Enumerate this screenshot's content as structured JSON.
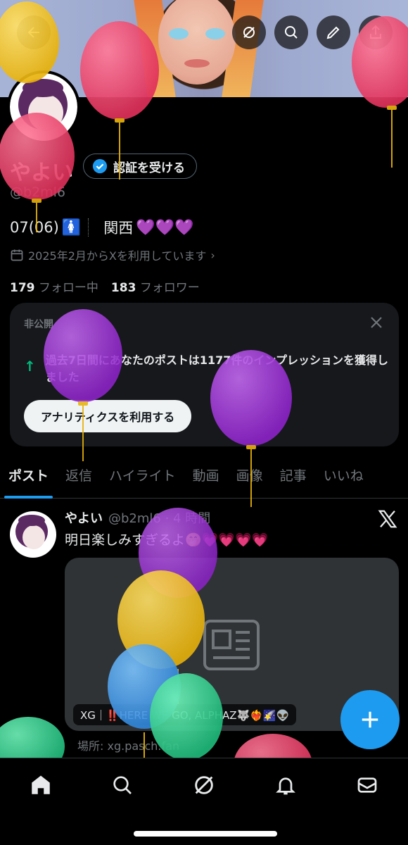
{
  "header": {
    "back_icon": "arrow-left-icon",
    "actions": [
      "grok-icon",
      "search-icon",
      "edit-icon",
      "share-icon"
    ]
  },
  "profile": {
    "name": "やよい",
    "verify_label": "認証を受ける",
    "handle": "@b2ml6",
    "bio_text_1": "07(06)",
    "bio_emoji_1": "🚺",
    "bio_text_2": "関西",
    "bio_emoji_2": "💜💜💜",
    "joined": "2025年2月からXを利用しています",
    "following_count": "179",
    "following_label": "フォロー中",
    "followers_count": "183",
    "followers_label": "フォロワー"
  },
  "analytics_card": {
    "label": "非公開",
    "message": "過去7日間にあなたのポストは1177件のインプレッションを獲得しました",
    "button": "アナリティクスを利用する"
  },
  "tabs": [
    "ポスト",
    "返信",
    "ハイライト",
    "動画",
    "画像",
    "記事",
    "いいね"
  ],
  "post": {
    "author": "やよい",
    "handle_time": "@b2ml6 · 4 時間",
    "text": "明日楽しみすぎるよ🤭💗💗💗💗",
    "card_caption": "XG｜‼️HERE WE GO, ALPHAZ🐺❤️‍🔥🌠👽",
    "domain": "場所: xg.pasch.fan"
  },
  "fab_icon": "plus-icon",
  "bottom_nav": [
    "home-icon",
    "search-icon",
    "grok-icon",
    "notifications-icon",
    "messages-icon"
  ],
  "colors": {
    "accent": "#1d9bf0",
    "positive": "#00ba7c",
    "balloon_red": "#e8365f",
    "balloon_yellow": "#f2c118",
    "balloon_purple": "#9b2fd6",
    "balloon_blue": "#3d9be9",
    "balloon_green": "#2ec98a"
  }
}
